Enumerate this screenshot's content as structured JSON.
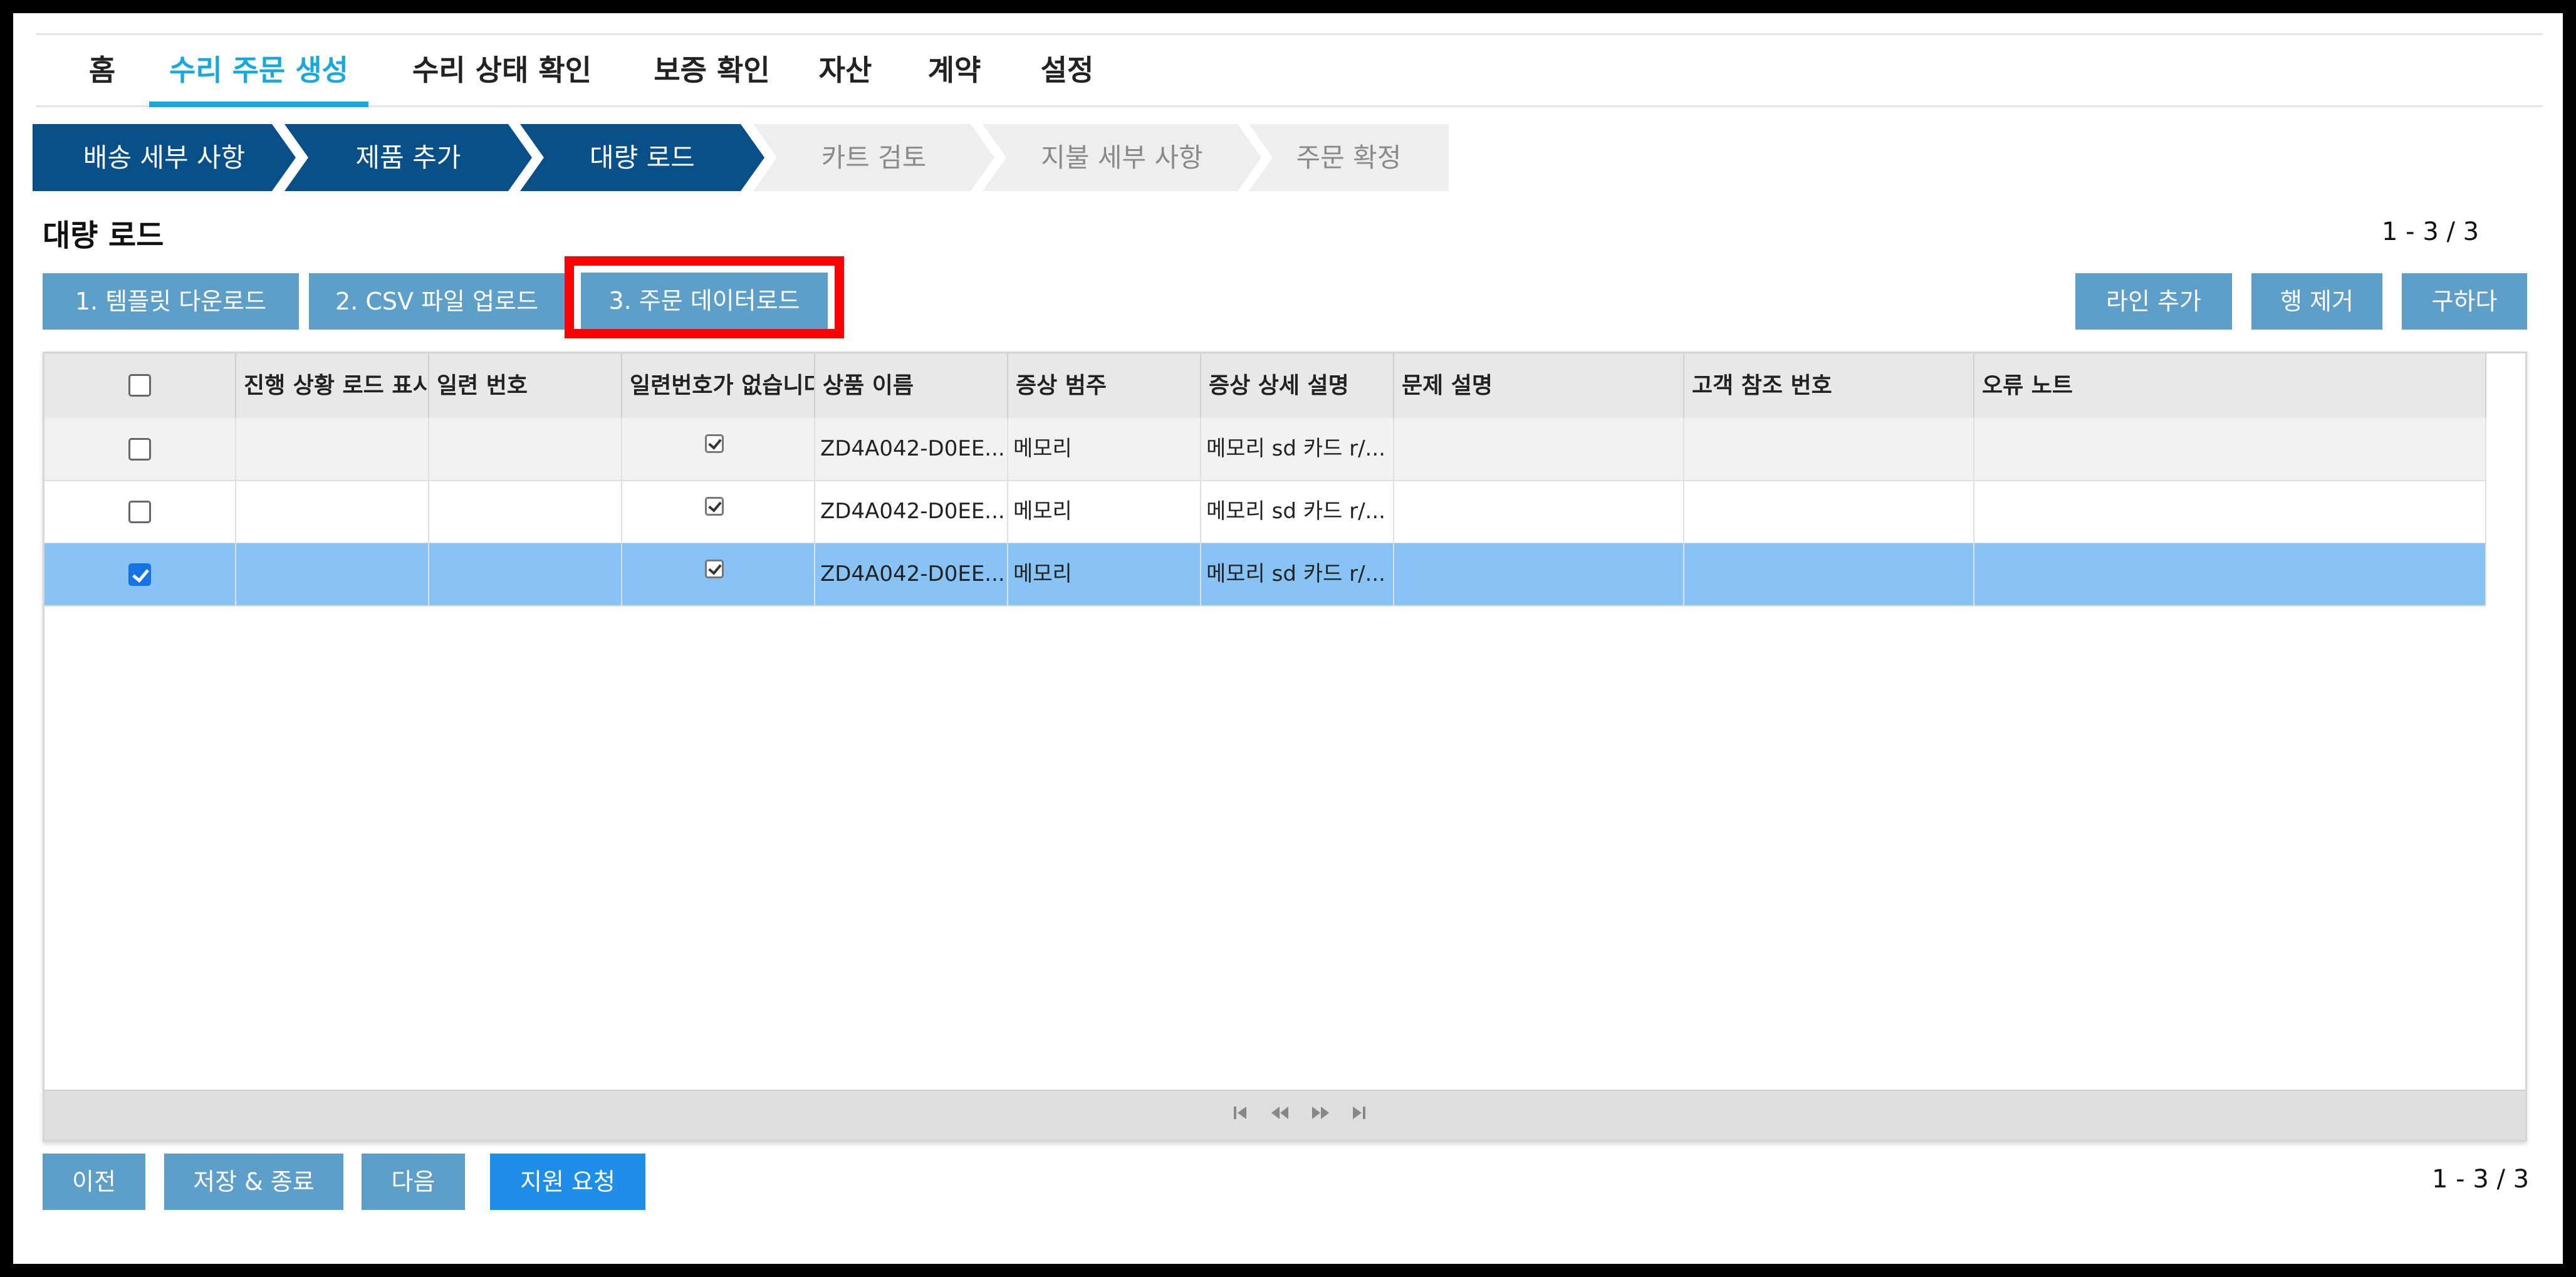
{
  "nav": {
    "tabs": [
      {
        "label": "홈"
      },
      {
        "label": "수리 주문 생성",
        "active": true
      },
      {
        "label": "수리 상태 확인"
      },
      {
        "label": "보증 확인"
      },
      {
        "label": "자산"
      },
      {
        "label": "계약"
      },
      {
        "label": "설정"
      }
    ]
  },
  "stepper": {
    "steps": [
      {
        "label": "배송 세부 사항",
        "state": "done"
      },
      {
        "label": "제품 추가",
        "state": "done"
      },
      {
        "label": "대량 로드",
        "state": "current"
      },
      {
        "label": "카트 검토",
        "state": "todo"
      },
      {
        "label": "지불 세부 사항",
        "state": "todo"
      },
      {
        "label": "주문 확정",
        "state": "todo"
      }
    ]
  },
  "section": {
    "title": "대량 로드",
    "count_top": "1 - 3 / 3",
    "count_bottom": "1 - 3 / 3"
  },
  "actions": {
    "template_download": "1. 템플릿 다운로드",
    "csv_upload": "2. CSV 파일 업로드",
    "order_data_load": "3. 주문 데이터로드",
    "add_line": "라인 추가",
    "remove_row": "행 제거",
    "save": "구하다"
  },
  "grid": {
    "headers": [
      "진행 상황 로드 표시",
      "일련 번호",
      "일련번호가 없습니다",
      "상품 이름",
      "증상 범주",
      "증상 상세 설명",
      "문제 설명",
      "고객 참조 번호",
      "오류 노트"
    ],
    "rows": [
      {
        "selected": false,
        "progress": "",
        "serial": "",
        "no_serial": true,
        "product": "ZD4A042-D0EE...",
        "category": "메모리",
        "detail": "메모리 sd 카드 r/...",
        "problem": "",
        "customer_ref": "",
        "error_note": ""
      },
      {
        "selected": false,
        "progress": "",
        "serial": "",
        "no_serial": true,
        "product": "ZD4A042-D0EE...",
        "category": "메모리",
        "detail": "메모리 sd 카드 r/...",
        "problem": "",
        "customer_ref": "",
        "error_note": ""
      },
      {
        "selected": true,
        "progress": "",
        "serial": "",
        "no_serial": true,
        "product": "ZD4A042-D0EE...",
        "category": "메모리",
        "detail": "메모리 sd 카드 r/...",
        "problem": "",
        "customer_ref": "",
        "error_note": ""
      }
    ],
    "pager_icons": [
      "first-page-icon",
      "prev-page-icon",
      "next-page-icon",
      "last-page-icon"
    ]
  },
  "footer": {
    "prev": "이전",
    "save_exit": "저장 & 종료",
    "next": "다음",
    "support": "지원 요청"
  },
  "colors": {
    "nav_active": "#18a8e0",
    "step_done": "#064f88",
    "button": "#5e9fc9",
    "button_primary": "#1f8ee8",
    "row_selected": "#87c3f4",
    "highlight": "#ff0000"
  }
}
